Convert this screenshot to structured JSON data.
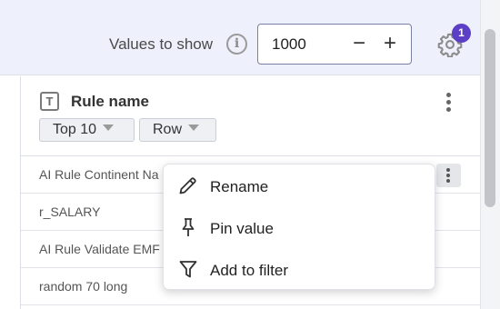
{
  "toolbar": {
    "values_label": "Values to show",
    "value": "1000",
    "minus": "−",
    "plus": "+",
    "badge_count": "1",
    "info_glyph": "i"
  },
  "column": {
    "type_glyph": "T",
    "title": "Rule name",
    "chips": [
      {
        "label": "Top 10"
      },
      {
        "label": "Row"
      }
    ]
  },
  "rows": [
    {
      "text": "AI Rule Continent Na"
    },
    {
      "text": "r_SALARY"
    },
    {
      "text": "AI Rule Validate EMF"
    },
    {
      "text": "random 70 long"
    }
  ],
  "menu": {
    "items": [
      {
        "label": "Rename",
        "icon": "pencil-icon"
      },
      {
        "label": "Pin value",
        "icon": "pin-icon"
      },
      {
        "label": "Add to filter",
        "icon": "filter-icon"
      }
    ]
  },
  "colors": {
    "accent": "#5b3fc4",
    "toolbar_bg": "#eef0fb"
  }
}
